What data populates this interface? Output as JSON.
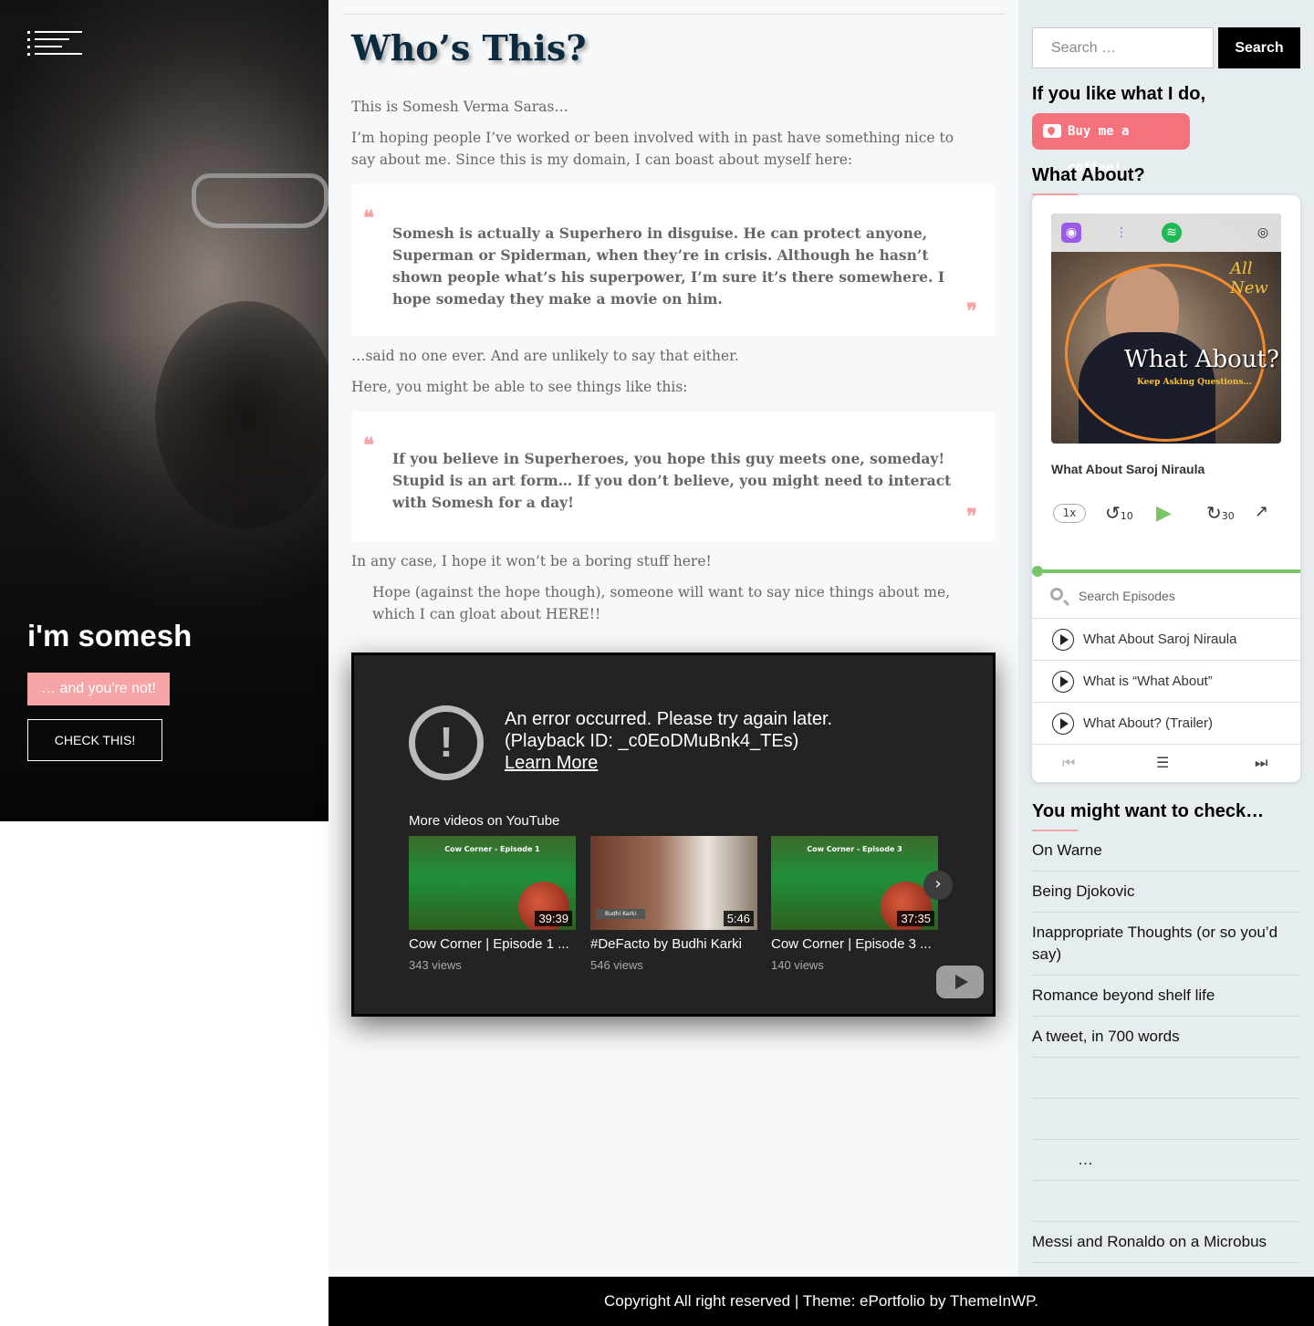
{
  "hero": {
    "title": "i'm somesh",
    "tagline": "… and you're not!",
    "button": "CHECK THIS!"
  },
  "main": {
    "title": "Who’s This?",
    "para1": "This is Somesh Verma Saras…",
    "para2": "I’m hoping people I’ve worked or been involved with in past have something nice to say about me. Since this is my domain, I can boast about myself here:",
    "quote1": "Somesh is actually a Superhero in disguise. He can protect anyone, Superman or Spiderman, when they’re in crisis. Although he hasn’t shown people what’s his superpower, I’m sure it’s there somewhere. I hope someday they make a movie on him.",
    "para3": "…said no one ever. And are unlikely to say that either.",
    "para4": "Here, you might be able to see things like this:",
    "quote2": "If you believe in Superheroes, you hope this guy meets one, someday! Stupid is an art form… If you don’t believe, you might need to interact with Somesh for a day!",
    "para5": "In any case, I hope it won’t be a boring stuff here!",
    "para6": "Hope (against the hope though), someone will want to say nice things about me, which I can gloat about HERE!!"
  },
  "video": {
    "error_line1": "An error occurred. Please try again later.",
    "error_line2": "(Playback ID: _c0EoDMuBnk4_TEs)",
    "learn_more": "Learn More",
    "more_videos": "More videos on YouTube",
    "items": [
      {
        "title": "Cow Corner | Episode 1 ...",
        "views": "343 views",
        "duration": "39:39",
        "thumb_label": "Cow Corner - Episode 1"
      },
      {
        "title": "#DeFacto by Budhi Karki",
        "views": "546 views",
        "duration": "5:46",
        "thumb_label": "Budhi Karki"
      },
      {
        "title": "Cow Corner | Episode 3 ...",
        "views": "140 views",
        "duration": "37:35",
        "thumb_label": "Cow Corner - Episode 3"
      }
    ]
  },
  "sidebar": {
    "search_placeholder": "Search …",
    "search_button": "Search",
    "widget1_title": "If you like what I do,",
    "kofi_label": "Buy me a coffee!",
    "widget2_title": "What About?",
    "player": {
      "cover_title": "What About?",
      "cover_subtitle": "Keep Asking Questions...",
      "cover_badge": "All New",
      "episode_title": "What About Saroj Niraula",
      "speed": "1x",
      "skip_back": "10",
      "skip_forward": "30",
      "search_placeholder": "Search Episodes",
      "episodes": [
        "What About Saroj Niraula",
        "What is “What About”",
        "What About? (Trailer)"
      ]
    },
    "widget3_title": "You might want to check…",
    "recent": [
      "On Warne",
      "Being Djokovic",
      "Inappropriate Thoughts (or so you’d say)",
      "Romance beyond shelf life",
      "A tweet, in 700 words",
      "",
      "",
      "…",
      "",
      "Messi and Ronaldo on a Microbus"
    ]
  },
  "footer": {
    "copyright": "Copyright All right reserved",
    "sep": " | ",
    "theme": "Theme: ePortfolio by ThemeInWP."
  },
  "colors": {
    "accent": "#f7a4a7",
    "title": "#0d2b3e",
    "sidebar_bg": "#e5edf1",
    "kofi": "#f4727c",
    "progress": "#78c466"
  }
}
